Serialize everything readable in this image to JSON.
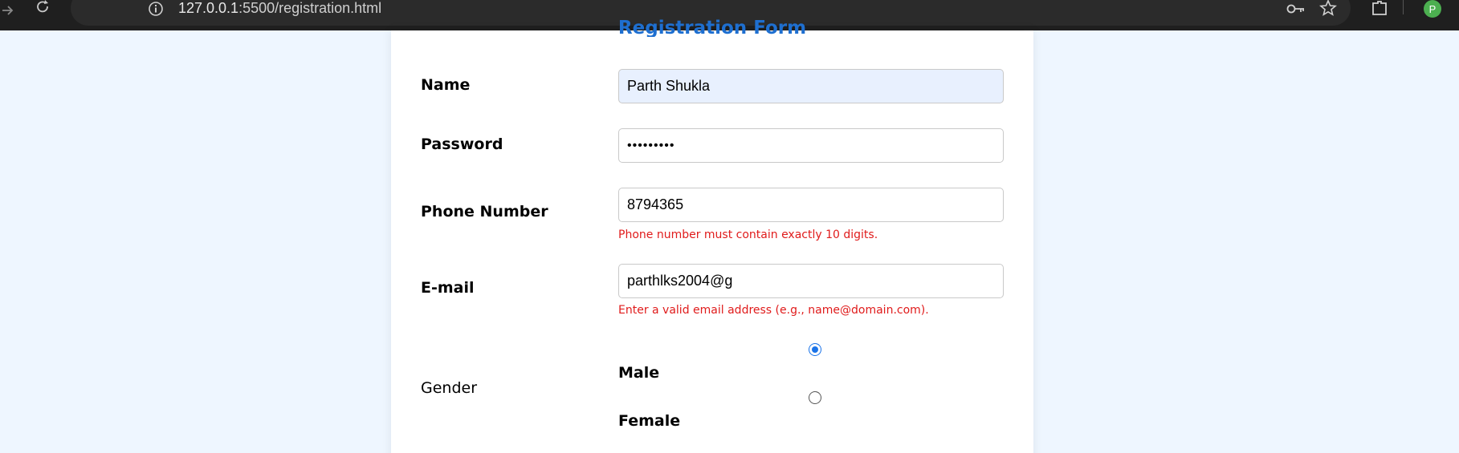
{
  "browser": {
    "url_host": "127.0.0.1",
    "url_rest": ":5500/registration.html",
    "profile_initial": "P",
    "icons": [
      "forward-icon",
      "reload-icon",
      "site-info-icon",
      "password-key-icon",
      "bookmark-star-icon",
      "extensions-icon"
    ]
  },
  "form": {
    "title": "Registration Form",
    "name": {
      "label": "Name",
      "value": "Parth Shukla"
    },
    "password": {
      "label": "Password",
      "value": "•••••••••"
    },
    "phone": {
      "label": "Phone Number",
      "value": "8794365",
      "error": "Phone number must contain exactly 10 digits."
    },
    "email": {
      "label": "E-mail",
      "value": "parthlks2004@g",
      "error": "Enter a valid email address (e.g., name@domain.com)."
    },
    "gender": {
      "label": "Gender",
      "options": [
        {
          "label": "Male",
          "checked": true
        },
        {
          "label": "Female",
          "checked": false
        }
      ]
    }
  },
  "colors": {
    "page_background": "#eef6ff",
    "title": "#1e6fd0",
    "error": "#e01b1b",
    "autofill": "#e8f0fe",
    "radio_accent": "#1a73e8"
  }
}
